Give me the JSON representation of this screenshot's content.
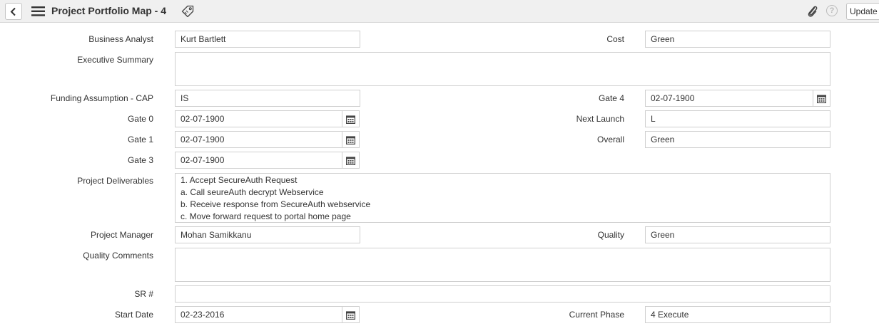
{
  "header": {
    "title": "Project Portfolio Map - 4",
    "update_label": "Update",
    "help_glyph": "?"
  },
  "form": {
    "business_analyst": {
      "label": "Business Analyst",
      "value": "Kurt Bartlett"
    },
    "cost": {
      "label": "Cost",
      "value": "Green"
    },
    "executive_summary": {
      "label": "Executive Summary",
      "value": ""
    },
    "funding_assumption": {
      "label": "Funding Assumption - CAP",
      "value": "IS"
    },
    "gate4": {
      "label": "Gate 4",
      "value": "02-07-1900"
    },
    "gate0": {
      "label": "Gate 0",
      "value": "02-07-1900"
    },
    "next_launch": {
      "label": "Next Launch",
      "value": "L"
    },
    "gate1": {
      "label": "Gate 1",
      "value": "02-07-1900"
    },
    "overall": {
      "label": "Overall",
      "value": "Green"
    },
    "gate3": {
      "label": "Gate 3",
      "value": "02-07-1900"
    },
    "project_deliverables": {
      "label": "Project Deliverables",
      "lines": [
        "1. Accept SecureAuth Request",
        "a. Call seureAuth decrypt Webservice",
        "b. Receive response from SecureAuth webservice",
        "c. Move forward request to portal home page"
      ]
    },
    "project_manager": {
      "label": "Project Manager",
      "value": "Mohan Samikkanu"
    },
    "quality": {
      "label": "Quality",
      "value": "Green"
    },
    "quality_comments": {
      "label": "Quality Comments",
      "value": ""
    },
    "sr_number": {
      "label": "SR #",
      "value": ""
    },
    "start_date": {
      "label": "Start Date",
      "value": "02-23-2016"
    },
    "current_phase": {
      "label": "Current Phase",
      "value": "4 Execute"
    }
  }
}
